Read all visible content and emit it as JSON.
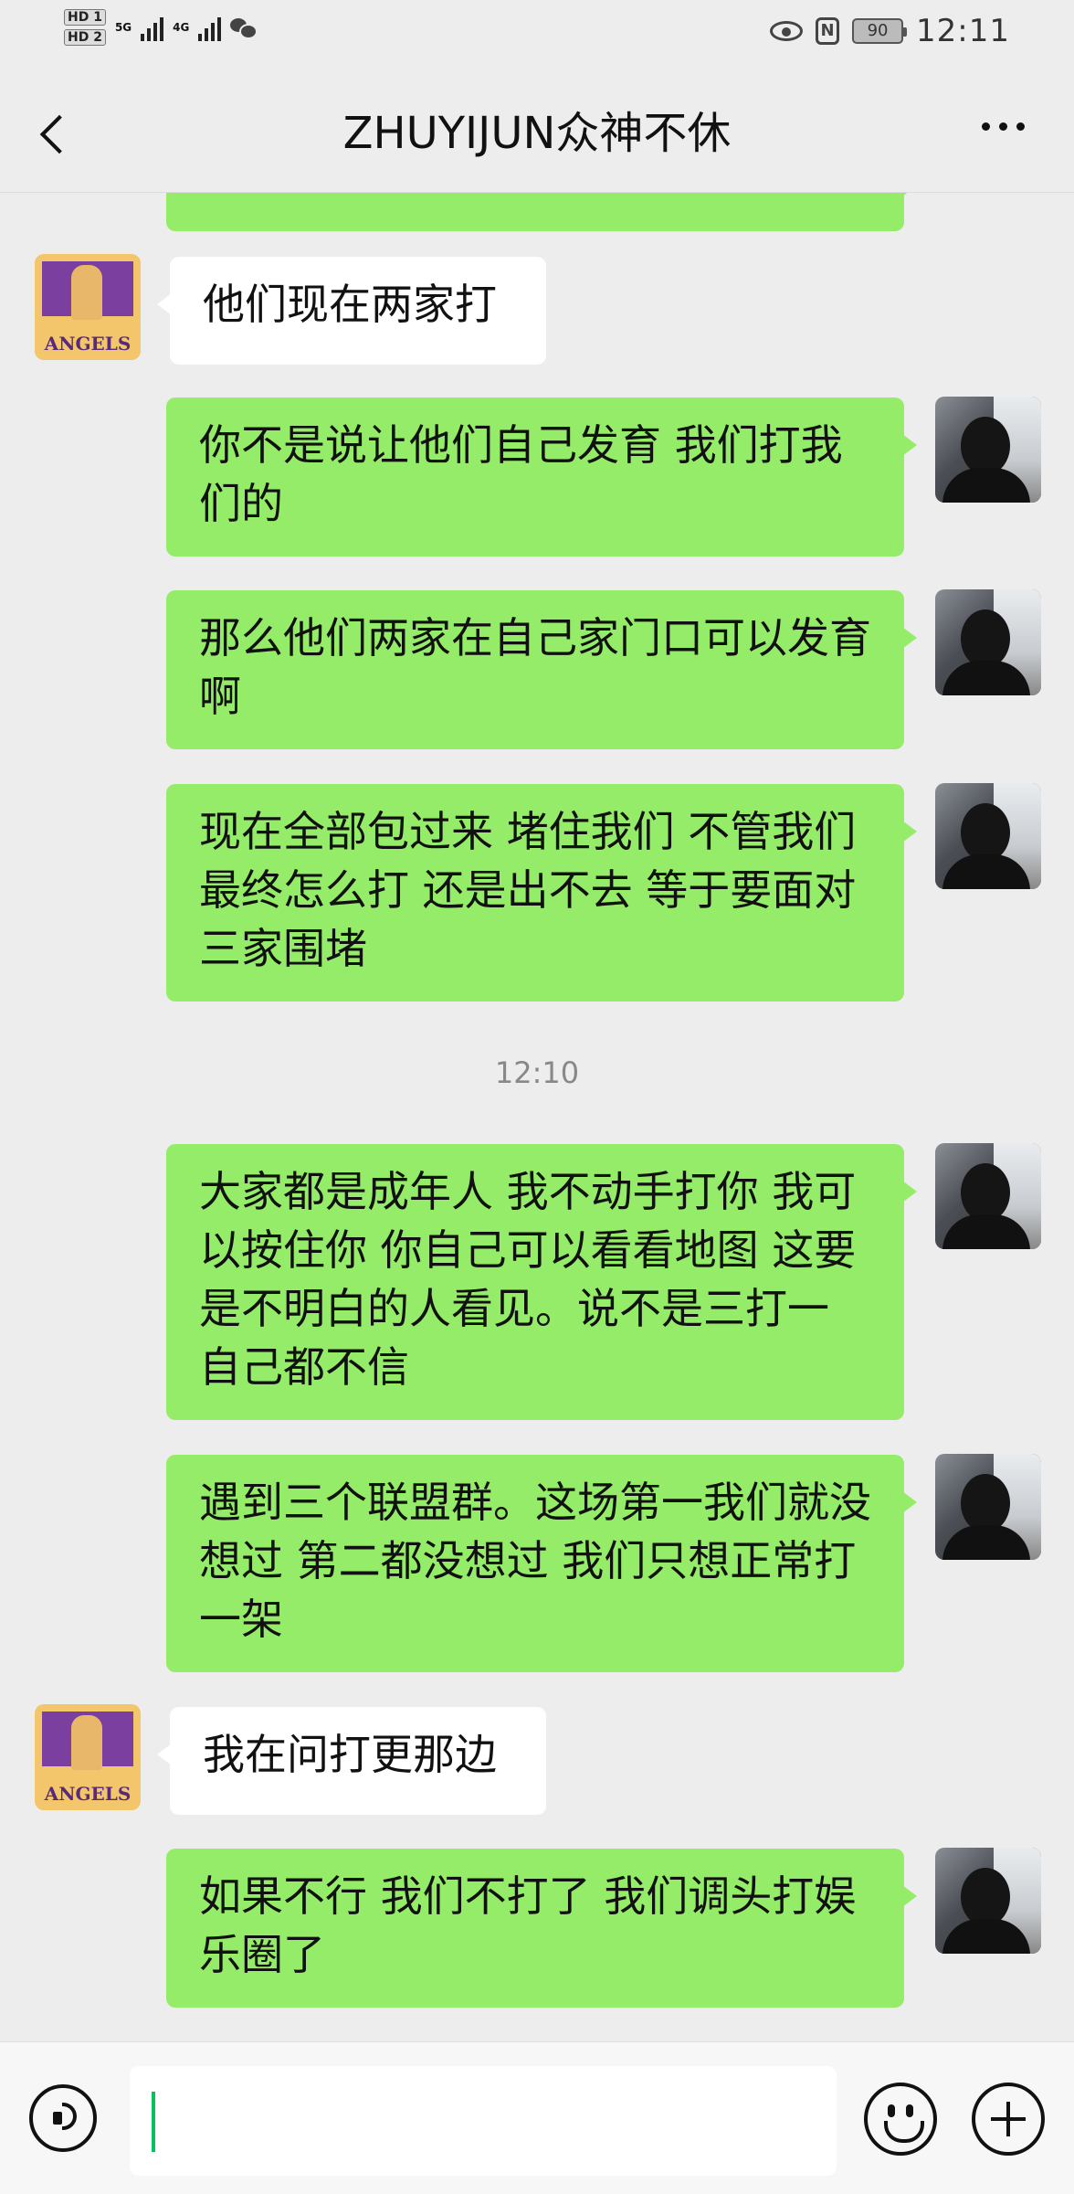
{
  "status_bar": {
    "sim1": "HD 1",
    "sim2": "HD 2",
    "network": "5G",
    "network2": "4G",
    "battery": "90",
    "time": "12:11"
  },
  "header": {
    "title": "ZHUYIJUN众神不休"
  },
  "messages": [
    {
      "sender": "other",
      "text": "他们现在两家打"
    },
    {
      "sender": "me",
      "text": "你不是说让他们自己发育 我们打我们的"
    },
    {
      "sender": "me",
      "text": "那么他们两家在自己家门口可以发育啊"
    },
    {
      "sender": "me",
      "text": "现在全部包过来 堵住我们  不管我们最终怎么打 还是出不去 等于要面对三家围堵"
    },
    {
      "timestamp": "12:10"
    },
    {
      "sender": "me",
      "text": "大家都是成年人 我不动手打你 我可以按住你 你自己可以看看地图 这要是不明白的人看见。说不是三打一 自己都不信"
    },
    {
      "sender": "me",
      "text": "遇到三个联盟群。这场第一我们就没想过 第二都没想过  我们只想正常打一架"
    },
    {
      "sender": "other",
      "text": "我在问打更那边"
    },
    {
      "sender": "me",
      "text": "如果不行 我们不打了 我们调头打娱乐圈了"
    }
  ],
  "other_avatar_text": "ANGELS",
  "colors": {
    "my_bubble": "#95ec69",
    "their_bubble": "#ffffff",
    "background": "#ededed",
    "cursor": "#07c160"
  }
}
